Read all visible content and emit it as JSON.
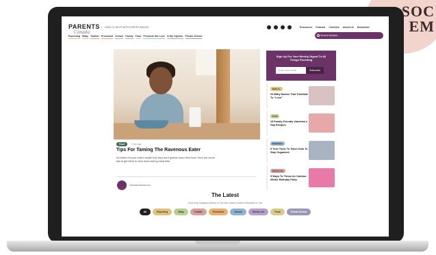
{
  "badge": {
    "line1": "SOC",
    "line2": "EM"
  },
  "header": {
    "logo": "PARENTS",
    "logo_sub": "Canada",
    "tagline": "HOW TO HELP WITH EXPERT ADVICE",
    "topnav": [
      "Resources",
      "Podcast",
      "Contests",
      "About Us",
      "Newsletter"
    ],
    "search_placeholder": "Search Articles",
    "nav": [
      {
        "label": "Expecting",
        "color": "#e0c27a"
      },
      {
        "label": "Baby",
        "color": "#b9cf8f"
      },
      {
        "label": "Toddler",
        "color": "#d9a0a0"
      },
      {
        "label": "Preschool",
        "color": "#e8b070"
      },
      {
        "label": "School",
        "color": "#8fb3d0"
      },
      {
        "label": "Family",
        "color": "#b7a0cc"
      },
      {
        "label": "Food",
        "color": "#d9c98a"
      },
      {
        "label": "Products We Love",
        "color": "#a0c8b8"
      },
      {
        "label": "In My Opinion",
        "color": "#c8a0b8"
      },
      {
        "label": "Private School",
        "color": "#9a9ab8"
      }
    ]
  },
  "hero": {
    "tag": "Food",
    "date": "2 hrs ago",
    "title": "Tips For Taming The Ravenous Eater",
    "desc": "It's better for your child's health that they don't gobble down their food. Here are some tips to get them to slow down during meal time.",
    "author": "ParentsCanada.com"
  },
  "signup": {
    "title": "Sign Up For Your Weekly Digest To All Things Parenting",
    "placeholder": "Enter your email",
    "button": "Subscribe"
  },
  "side_cards": [
    {
      "tag": "Baby 0+",
      "tag_color": "#e0c27a",
      "title": "20 Baby Names That Translate To \"Love\"",
      "thumb": "#d8c2c2"
    },
    {
      "tag": "Food",
      "tag_color": "#b9cf8f",
      "title": "15 Family-Friendly Valentine's Day Recipes",
      "thumb": "#e6a8a8"
    },
    {
      "tag": "Education",
      "tag_color": "#8fb3d0",
      "title": "5 Tech Tools To Teach Kids To Stay Organized",
      "thumb": "#a8b4c2"
    },
    {
      "tag": "Family Life",
      "tag_color": "#d9a0a0",
      "title": "5 Ways To Throw An Outdoor Winter Birthday Party",
      "thumb": "#e87aa8"
    }
  ],
  "latest": {
    "title": "The Latest",
    "subtitle": "Click Any Category Below to Get the Latest Content Relevant to You",
    "chips": [
      {
        "label": "All",
        "color": "#222222",
        "text": "#ffffff"
      },
      {
        "label": "Expecting",
        "color": "#e0c27a",
        "text": "#333333"
      },
      {
        "label": "Baby",
        "color": "#b9cf8f",
        "text": "#333333"
      },
      {
        "label": "Toddler",
        "color": "#d9a0a0",
        "text": "#333333"
      },
      {
        "label": "Preschool",
        "color": "#e8b070",
        "text": "#333333"
      },
      {
        "label": "School",
        "color": "#8fb3d0",
        "text": "#333333"
      },
      {
        "label": "Family Life",
        "color": "#b7a0cc",
        "text": "#333333"
      },
      {
        "label": "Food",
        "color": "#d9c98a",
        "text": "#333333"
      },
      {
        "label": "Private School",
        "color": "#9a9ab8",
        "text": "#ffffff"
      }
    ]
  }
}
